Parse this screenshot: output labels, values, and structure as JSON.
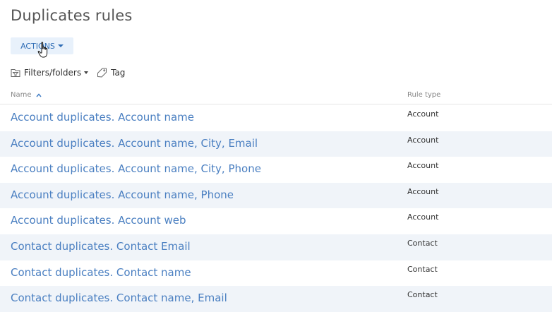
{
  "page": {
    "title": "Duplicates rules"
  },
  "actions": {
    "label": "ACTIONS"
  },
  "toolbar": {
    "filters_label": "Filters/folders",
    "tag_label": "Tag"
  },
  "grid": {
    "columns": {
      "name": "Name",
      "rule_type": "Rule type"
    },
    "rows": [
      {
        "name": "Account duplicates. Account name",
        "type": "Account"
      },
      {
        "name": "Account duplicates. Account name, City, Email",
        "type": "Account"
      },
      {
        "name": "Account duplicates. Account name, City, Phone",
        "type": "Account"
      },
      {
        "name": "Account duplicates. Account name, Phone",
        "type": "Account"
      },
      {
        "name": "Account duplicates. Account web",
        "type": "Account"
      },
      {
        "name": "Contact duplicates. Contact Email",
        "type": "Contact"
      },
      {
        "name": "Contact duplicates. Contact name",
        "type": "Contact"
      },
      {
        "name": "Contact duplicates. Contact name, Email",
        "type": "Contact"
      }
    ]
  },
  "icons": {
    "actions_caret": "caret-down-icon",
    "cursor": "hand-pointer-icon",
    "filters": "filter-folders-icon",
    "filters_caret": "caret-down-icon",
    "tag": "tag-icon",
    "sort": "sort-ascending-icon"
  },
  "colors": {
    "link": "#4a7fc1",
    "accent": "#2f6db5",
    "button_bg": "#e8f1fb",
    "row_alt_bg": "#f0f4f9"
  }
}
